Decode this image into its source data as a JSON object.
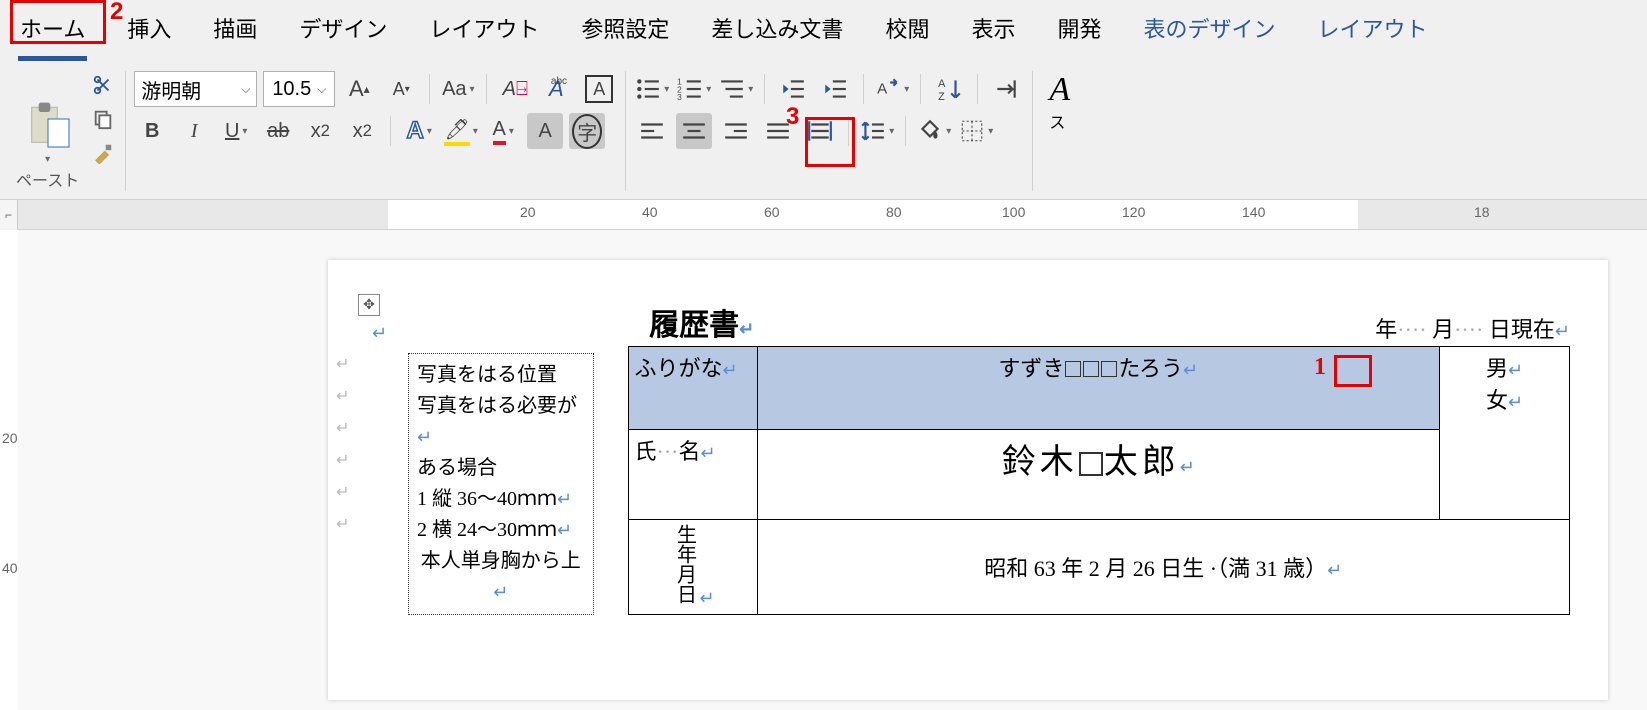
{
  "tabs": {
    "home": "ホーム",
    "insert": "挿入",
    "draw": "描画",
    "design": "デザイン",
    "layout": "レイアウト",
    "references": "参照設定",
    "mailings": "差し込み文書",
    "review": "校閲",
    "view": "表示",
    "developer": "開発",
    "tabledesign": "表のデザイン",
    "tablelayout": "レイアウト"
  },
  "font": {
    "name": "游明朝",
    "size": "10.5"
  },
  "clipboard": {
    "paste": "ペースト"
  },
  "callouts": {
    "n1": "1",
    "n2": "2",
    "n3": "3"
  },
  "ruler": {
    "m20": "20",
    "m40": "40",
    "m60": "60",
    "m80": "80",
    "m100": "100",
    "m120": "120",
    "m140": "140",
    "m18": "18"
  },
  "vruler": {
    "v20": "20",
    "v40": "40"
  },
  "cv": {
    "title": "履歴書",
    "date_year": "年",
    "date_month": "月",
    "date_day_now": "日現在",
    "furigana_label": "ふりがな",
    "furigana_value_pre": "すずき",
    "furigana_value_post": "たろう",
    "name_label_shi": "氏",
    "name_label_mei": "名",
    "name_sur": "鈴木",
    "name_given": "太郎",
    "gender_m": "男",
    "gender_f": "女",
    "birth_label": "生年月日",
    "birth_value": "昭和 63 年 2 月 26 日生 ·（満 31 歳）",
    "photo_l1": "写真をはる位置",
    "photo_l2": "写真をはる必要が",
    "photo_l3": "ある場合",
    "photo_l4": "1 縦 36～40ｍｍ",
    "photo_l5": "2 横 24～30ｍｍ",
    "photo_l6": "本人単身胸から上"
  },
  "right_label": "ス"
}
